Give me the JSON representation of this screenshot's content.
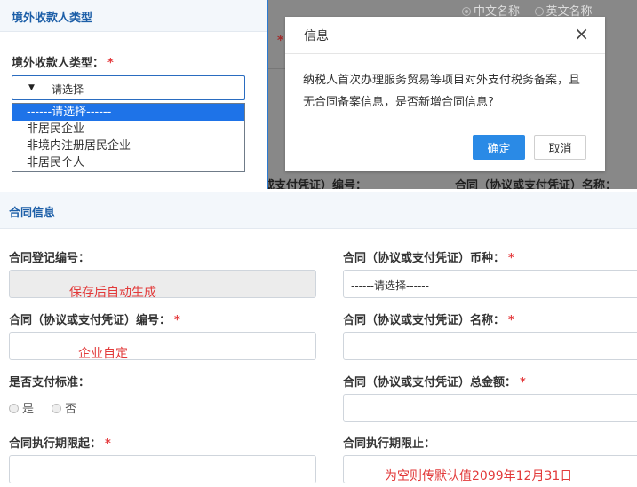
{
  "top_panel": {
    "header": "境外收款人类型",
    "label": "境外收款人类型：",
    "required_mark": "*",
    "select_value": "------请选择------",
    "options": [
      "------请选择------",
      "非居民企业",
      "非境内注册居民企业",
      "非居民个人"
    ]
  },
  "background": {
    "radio_chinese": "中文名称",
    "radio_english": "英文名称",
    "star": "*",
    "left_text": "或支付凭证）编号：",
    "right_text": "合同（协议或支付凭证）名称："
  },
  "modal": {
    "title": "信息",
    "close": "×",
    "message": "纳税人首次办理服务贸易等项目对外支付税务备案，且无合同备案信息，是否新增合同信息?",
    "ok_label": "确定",
    "cancel_label": "取消"
  },
  "contract": {
    "header": "合同信息",
    "reg_no_label": "合同登记编号：",
    "reg_no_note": "保存后自动生成",
    "currency_label": "合同（协议或支付凭证）币种：",
    "currency_value": "------请选择------",
    "contract_no_label": "合同（协议或支付凭证）编号：",
    "contract_no_note": "企业自定",
    "contract_name_label": "合同（协议或支付凭证）名称：",
    "pay_std_label": "是否支付标准：",
    "pay_std_yes": "是",
    "pay_std_no": "否",
    "total_label": "合同（协议或支付凭证）总金额：",
    "start_label": "合同执行期限起：",
    "end_label": "合同执行期限止：",
    "end_note": "为空则传默认值2099年12月31日",
    "required_mark": "*"
  },
  "colors": {
    "accent": "#2a8ae6",
    "header_text": "#1d5fa8",
    "required": "#e4393c",
    "note": "#e23a3a"
  }
}
